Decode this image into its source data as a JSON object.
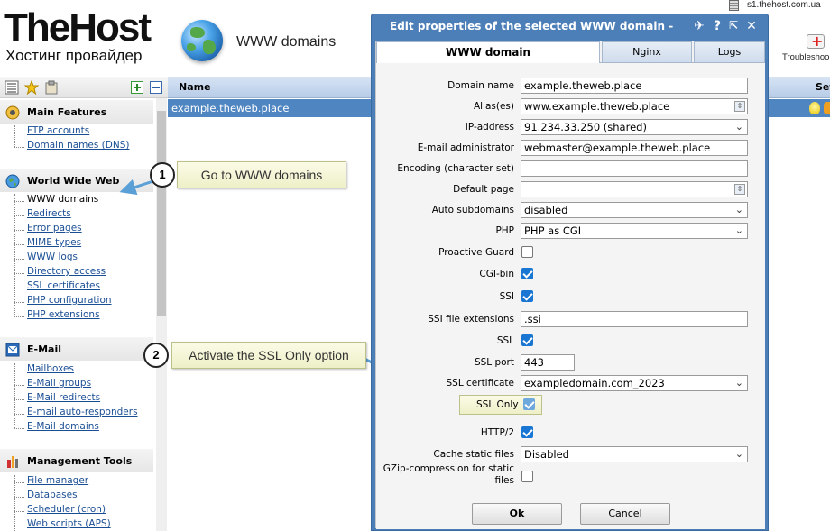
{
  "header": {
    "logo_main": "TheHost",
    "logo_sub": "Хостинг провайдер",
    "page_title": "WWW domains",
    "server": "s1.thehost.com.ua",
    "troubleshoot_label": "Troubleshoo"
  },
  "table": {
    "col_name": "Name",
    "col_settings": "Set",
    "rows": [
      {
        "name": "example.theweb.place"
      }
    ]
  },
  "sidebar": {
    "sections": [
      {
        "title": "Main Features",
        "items": [
          "FTP accounts",
          "Domain names (DNS)"
        ]
      },
      {
        "title": "World Wide Web",
        "items": [
          "WWW domains",
          "Redirects",
          "Error pages",
          "MIME types",
          "WWW logs",
          "Directory access",
          "SSL certificates",
          "PHP configuration",
          "PHP extensions"
        ]
      },
      {
        "title": "E-Mail",
        "items": [
          "Mailboxes",
          "E-Mail groups",
          "E-Mail redirects",
          "E-mail auto-responders",
          "E-Mail domains"
        ]
      },
      {
        "title": "Management Tools",
        "items": [
          "File manager",
          "Databases",
          "Scheduler (cron)",
          "Web scripts (APS)"
        ]
      }
    ]
  },
  "callouts": [
    {
      "number": "1",
      "text": "Go to WWW domains"
    },
    {
      "number": "2",
      "text": "Activate the SSL Only option"
    }
  ],
  "dialog": {
    "title": "Edit properties of the selected WWW domain - exa",
    "tabs": [
      "WWW domain",
      "Nginx",
      "Logs"
    ],
    "fields": {
      "domain_name": {
        "label": "Domain name",
        "value": "example.theweb.place"
      },
      "aliases": {
        "label": "Alias(es)",
        "value": "www.example.theweb.place"
      },
      "ip": {
        "label": "IP-address",
        "value": "91.234.33.250 (shared)"
      },
      "email_admin": {
        "label": "E-mail administrator",
        "value": "webmaster@example.theweb.place"
      },
      "encoding": {
        "label": "Encoding (character set)",
        "value": ""
      },
      "default_page": {
        "label": "Default page",
        "value": ""
      },
      "auto_subdomains": {
        "label": "Auto subdomains",
        "value": "disabled"
      },
      "php": {
        "label": "PHP",
        "value": "PHP as CGI"
      },
      "proactive_guard": {
        "label": "Proactive Guard",
        "checked": false
      },
      "cgi_bin": {
        "label": "CGI-bin",
        "checked": true
      },
      "ssi": {
        "label": "SSI",
        "checked": true
      },
      "ssi_ext": {
        "label": "SSI file extensions",
        "value": ".ssi"
      },
      "ssl": {
        "label": "SSL",
        "checked": true
      },
      "ssl_port": {
        "label": "SSL port",
        "value": "443"
      },
      "ssl_cert": {
        "label": "SSL certificate",
        "value": "exampledomain.com_2023"
      },
      "ssl_only": {
        "label": "SSL Only",
        "checked": true
      },
      "http2": {
        "label": "HTTP/2",
        "checked": true
      },
      "cache_static": {
        "label": "Cache static files",
        "value": "Disabled"
      },
      "gzip": {
        "label": "GZip-compression for static files",
        "checked": false
      }
    },
    "ok_label": "Ok",
    "cancel_label": "Cancel"
  }
}
